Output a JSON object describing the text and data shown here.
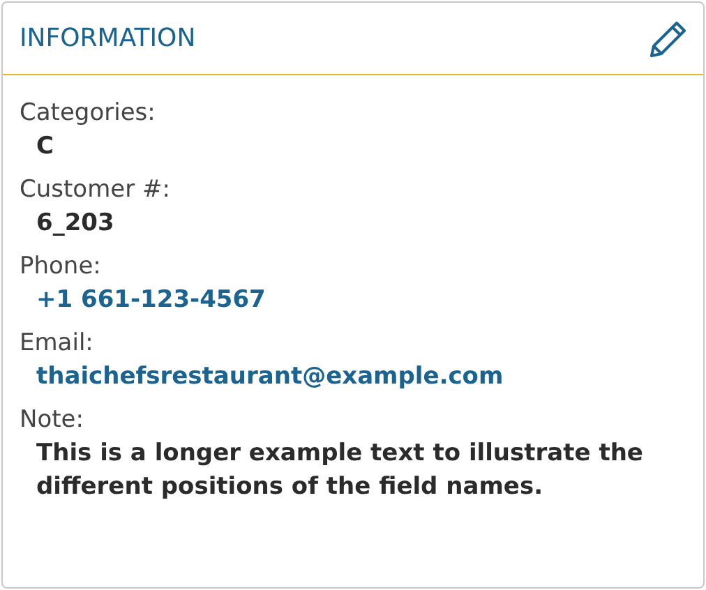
{
  "panel": {
    "title": "INFORMATION"
  },
  "fields": [
    {
      "label": "Categories:",
      "value": "C",
      "kind": "text"
    },
    {
      "label": "Customer #:",
      "value": "6_203",
      "kind": "text"
    },
    {
      "label": "Phone:",
      "value": "+1 661-123-4567",
      "kind": "link"
    },
    {
      "label": "Email:",
      "value": "thaichefsrestaurant@example.com",
      "kind": "link"
    },
    {
      "label": "Note:",
      "value": "This is a longer example text to illustrate the different positions of the field names.",
      "kind": "text"
    }
  ]
}
